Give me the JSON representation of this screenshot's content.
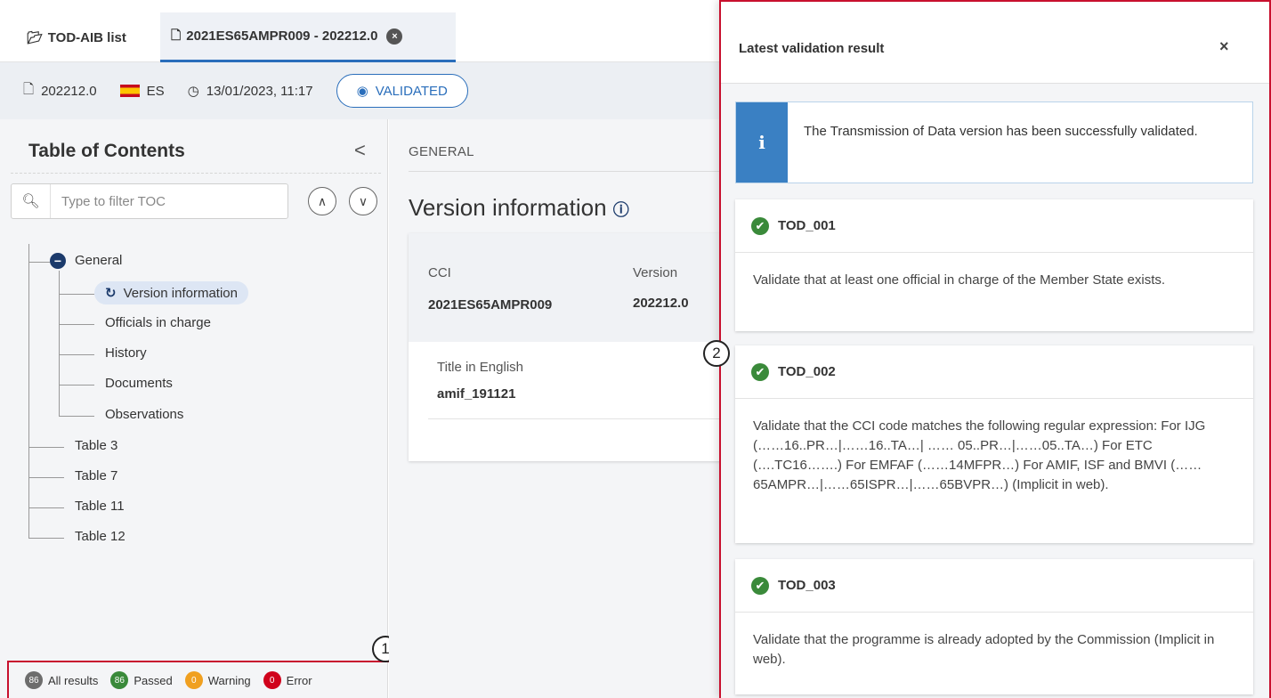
{
  "tabs": {
    "list_label": "TOD-AIB list",
    "doc_label": "2021ES65AMPR009 - 202212.0",
    "close_glyph": "×"
  },
  "infobar": {
    "version": "202212.0",
    "country": "ES",
    "datetime": "13/01/2023, 11:17",
    "status": "VALIDATED"
  },
  "toc": {
    "title": "Table of Contents",
    "collapse_glyph": "<",
    "search_placeholder": "Type to filter TOC",
    "tree": {
      "general": "General",
      "version_information": "Version information",
      "officials_in_charge": "Officials in charge",
      "history": "History",
      "documents": "Documents",
      "observations": "Observations",
      "table3": "Table 3",
      "table7": "Table 7",
      "table11": "Table 11",
      "table12": "Table 12"
    }
  },
  "results": {
    "all_count": "86",
    "all_label": "All results",
    "passed_count": "86",
    "passed_label": "Passed",
    "warning_count": "0",
    "warning_label": "Warning",
    "error_count": "0",
    "error_label": "Error",
    "colors": {
      "all": "#6d6d6d",
      "passed": "#3a8a3a",
      "warning": "#f0a020",
      "error": "#d0021b"
    }
  },
  "callouts": {
    "one": "1",
    "two": "2"
  },
  "content": {
    "breadcrumb": "GENERAL",
    "heading": "Version information",
    "cci_label": "CCI",
    "cci_value": "2021ES65AMPR009",
    "version_label": "Version",
    "version_value": "202212.0",
    "title_label": "Title in English",
    "title_value": "amif_191121"
  },
  "panel": {
    "title": "Latest validation result",
    "close_glyph": "×",
    "info_icon": "i",
    "info_text": "The Transmission of Data version has been successfully validated.",
    "rules": [
      {
        "code": "TOD_001",
        "text": "Validate that at least one official in charge of the Member State exists."
      },
      {
        "code": "TOD_002",
        "text": "Validate that the CCI code matches the following regular expression: For IJG (……16..PR…|……16..TA…| …… 05..PR…|……05..TA…) For ETC (….TC16…….) For EMFAF (……14MFPR…) For AMIF, ISF and BMVI (…… 65AMPR…|……65ISPR…|……65BVPR…) (Implicit in web)."
      },
      {
        "code": "TOD_003",
        "text": "Validate that the programme is already adopted by the Commission (Implicit in web)."
      }
    ]
  }
}
